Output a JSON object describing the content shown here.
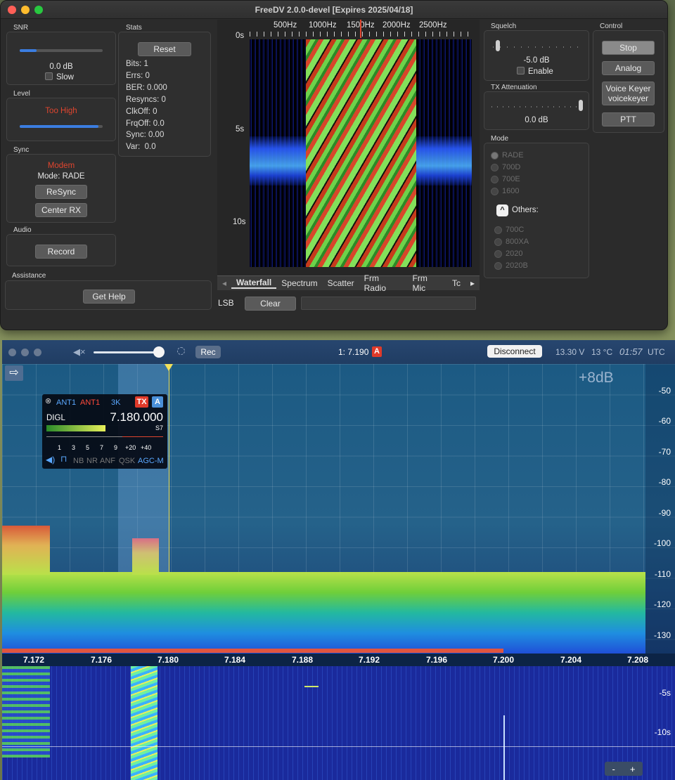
{
  "freedv": {
    "title": "FreeDV 2.0.0-devel [Expires 2025/04/18]",
    "snr": {
      "label": "SNR",
      "value": "0.0 dB",
      "slow_label": "Slow",
      "level": 0.2
    },
    "level": {
      "label": "Level",
      "status": "Too High",
      "level": 0.95
    },
    "sync": {
      "label": "Sync",
      "status": "Modem",
      "mode_text": "Mode: RADE",
      "resync": "ReSync",
      "center_rx": "Center RX"
    },
    "audio": {
      "label": "Audio",
      "record": "Record"
    },
    "assistance": {
      "label": "Assistance",
      "get_help": "Get Help"
    },
    "stats": {
      "label": "Stats",
      "reset": "Reset",
      "lines": [
        "Bits: 1",
        "Errs: 0",
        "BER: 0.000",
        "Resyncs: 0",
        "ClkOff: 0",
        "FrqOff: 0.0",
        "Sync: 0.00",
        "Var:  0.0"
      ]
    },
    "waterfall": {
      "freq_labels": [
        "500Hz",
        "1000Hz",
        "1500Hz",
        "2000Hz",
        "2500Hz"
      ],
      "time_labels": [
        "0s",
        "5s",
        "10s"
      ]
    },
    "tabs": [
      "Waterfall",
      "Spectrum",
      "Scatter",
      "Frm Radio",
      "Frm Mic",
      "Tc"
    ],
    "active_tab": "Waterfall",
    "sideband": "LSB",
    "clear": "Clear",
    "squelch": {
      "label": "Squelch",
      "value": "-5.0 dB",
      "enable": "Enable"
    },
    "tx_atten": {
      "label": "TX Attenuation",
      "value": "0.0 dB"
    },
    "mode": {
      "label": "Mode",
      "options": [
        "RADE",
        "700D",
        "700E",
        "1600"
      ],
      "selected": "RADE",
      "others_label": "Others:",
      "others": [
        "700C",
        "800XA",
        "2020",
        "2020B"
      ]
    },
    "control": {
      "label": "Control",
      "stop": "Stop",
      "analog": "Analog",
      "voice_keyer": "Voice Keyer",
      "voice_keyer_file": "voicekeyer",
      "ptt": "PTT"
    }
  },
  "sdr": {
    "rec": "Rec",
    "vfo": "1: 7.190",
    "vfo_badge": "A",
    "disconnect": "Disconnect",
    "voltage": "13.30 V",
    "temp": "13 °C",
    "time": "01:57",
    "tz": "UTC",
    "gain": "+8dB",
    "db_scale": [
      "-50",
      "-60",
      "-70",
      "-80",
      "-90",
      "-100",
      "-110",
      "-120",
      "-130"
    ],
    "freq_ticks": [
      "7.172",
      "7.176",
      "7.180",
      "7.184",
      "7.188",
      "7.192",
      "7.196",
      "7.200",
      "7.204",
      "7.208"
    ],
    "wf_times": [
      "-5s",
      "-10s"
    ],
    "slice": {
      "ant_rx": "ANT1",
      "ant_tx": "ANT1",
      "bw": "3K",
      "tx": "TX",
      "letter": "A",
      "mode": "DIGL",
      "freq": "7.180.000",
      "s_reading": "S7",
      "meter_scale": [
        "1",
        "3",
        "5",
        "7",
        "9",
        "+20",
        "+40"
      ],
      "dsp": [
        "NB",
        "NR",
        "ANF",
        "QSK",
        "AGC-M"
      ]
    },
    "zoom_minus": "-",
    "zoom_plus": "+"
  },
  "colors": {
    "accent": "#3b7de0",
    "alert": "#e0452f",
    "tx_red": "#e03a2a"
  }
}
